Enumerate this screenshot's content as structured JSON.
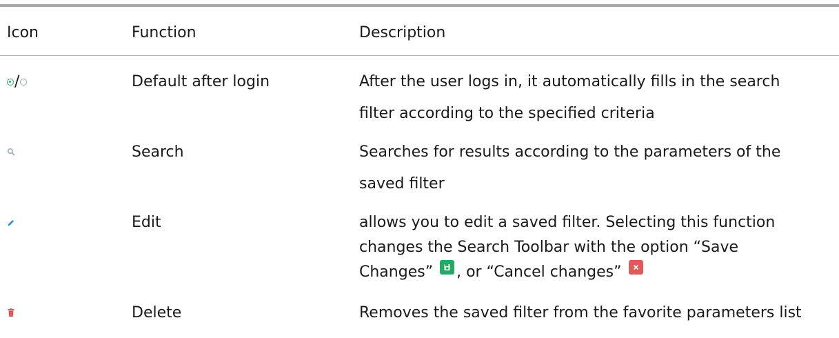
{
  "table": {
    "headers": {
      "icon": "Icon",
      "function": "Function",
      "description": "Description"
    },
    "rows": [
      {
        "icon": "radio-selected-unselected-icon",
        "icon_separator": "/",
        "function": "Default after login",
        "description_lines": [
          "After the user logs in, it automatically fills in the search",
          "filter according to the specified criteria"
        ]
      },
      {
        "icon": "search-icon",
        "function": "Search",
        "description_lines": [
          "Searches for results according to the parameters of the",
          "saved filter"
        ]
      },
      {
        "icon": "pencil-icon",
        "function": "Edit",
        "description_lines": [
          "allows you to edit a saved filter. Selecting this function",
          "changes the Search Toolbar with the option “Save"
        ],
        "description_line3_a": "Changes”",
        "description_line3_b": ", or “Cancel changes”",
        "save_button_icon": "save-icon",
        "cancel_button_icon": "close-icon"
      },
      {
        "icon": "trash-icon",
        "function": "Delete",
        "description_lines": [
          "Removes the saved filter from the favorite parameters list"
        ]
      }
    ]
  },
  "colors": {
    "radio_selected": "#2eaa6a",
    "radio_unselected": "#9aa7b4",
    "search_icon": "#9ab0c4",
    "pencil_icon": "#1f8fd6",
    "trash_icon": "#e05a5a",
    "save_button": "#26a866",
    "cancel_button": "#e15a5a",
    "rule": "#a9a9a9"
  }
}
